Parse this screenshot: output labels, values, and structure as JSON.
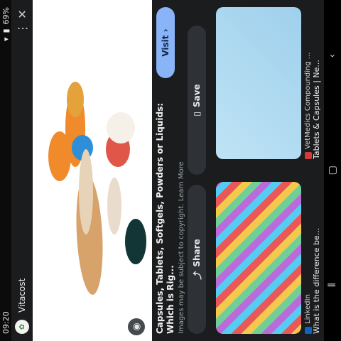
{
  "status": {
    "time": "09:20",
    "battery": "69%"
  },
  "source": {
    "name": "Vitacost"
  },
  "info": {
    "title": "Capsules, Tablets, Softgels, Powders or Liquids: Which is Rig...",
    "copyright": "Images may be subject to copyright. Learn More",
    "visit_label": "Visit",
    "share_label": "Share",
    "save_label": "Save"
  },
  "related": [
    {
      "source": "LinkedIn",
      "caption": "What is the difference be..."
    },
    {
      "source": "VetMedics Compounding ...",
      "caption": "Tablets & Capsules | Ne..."
    }
  ],
  "colors": {
    "visit": "#8ab4f8",
    "background": "#1a1c1e"
  }
}
